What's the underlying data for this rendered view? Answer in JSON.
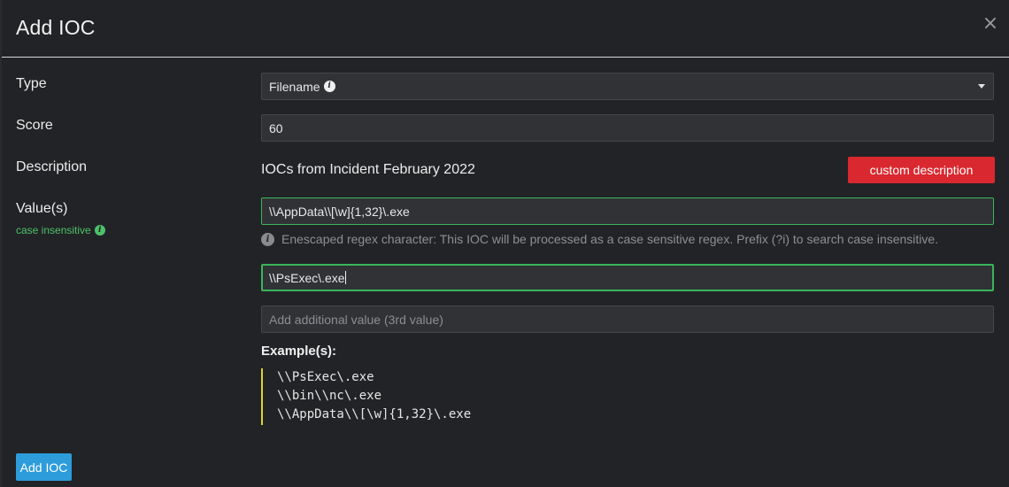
{
  "modal": {
    "title": "Add IOC",
    "close_glyph": "×"
  },
  "labels": {
    "type": "Type",
    "score": "Score",
    "description": "Description",
    "values": "Value(s)",
    "case_note": "case insensitive"
  },
  "type_select": {
    "selected": "Filename"
  },
  "score": {
    "value": "60"
  },
  "description": {
    "text": "IOCs from Incident February 2022",
    "custom_button": "custom description"
  },
  "values": {
    "value1": "\\\\AppData\\\\[\\w]{1,32}\\.exe",
    "warning": "Enescaped regex character: This IOC will be processed as a case sensitive regex. Prefix (?i) to search case insensitive.",
    "value2": "\\\\PsExec\\.exe",
    "value3_placeholder": "Add additional value (3rd value)"
  },
  "examples": {
    "title": "Example(s):",
    "lines": [
      "\\\\PsExec\\.exe",
      "\\\\bin\\\\nc\\.exe",
      "\\\\AppData\\\\[\\w]{1,32}\\.exe"
    ]
  },
  "actions": {
    "add_button": "Add IOC"
  },
  "icons": {
    "info": "info-icon",
    "close": "close-icon",
    "dropdown": "chevron-down-icon"
  },
  "colors": {
    "valid_border": "#3bb55a",
    "danger": "#d9282f",
    "primary": "#2d9cdb",
    "example_bar": "#e0d23c"
  }
}
